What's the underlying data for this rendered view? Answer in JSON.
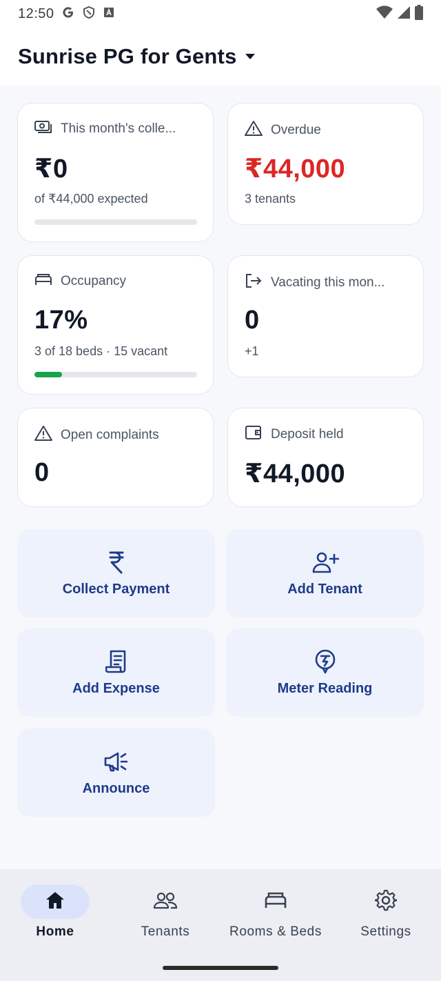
{
  "status_bar": {
    "time": "12:50",
    "left_icons": [
      "google-icon",
      "shield-icon",
      "font-icon"
    ],
    "right_icons": [
      "wifi-icon",
      "signal-icon",
      "battery-icon"
    ]
  },
  "header": {
    "title": "Sunrise PG for Gents"
  },
  "stats": {
    "collection": {
      "label": "This month's colle...",
      "value": "₹0",
      "sub": "of ₹44,000 expected",
      "progress": 0
    },
    "overdue": {
      "label": "Overdue",
      "value": "₹44,000",
      "sub": "3 tenants",
      "value_color": "#dc2626"
    },
    "occupancy": {
      "label": "Occupancy",
      "value": "17%",
      "sub": "3 of 18 beds · 15 vacant",
      "progress": 0.17
    },
    "vacating": {
      "label": "Vacating this mon...",
      "value": "0",
      "sub": "+1"
    },
    "complaints": {
      "label": "Open complaints",
      "value": "0"
    },
    "deposit": {
      "label": "Deposit held",
      "value": "₹44,000"
    }
  },
  "actions": {
    "collect_payment": "Collect Payment",
    "add_tenant": "Add Tenant",
    "add_expense": "Add Expense",
    "meter_reading": "Meter Reading",
    "announce": "Announce"
  },
  "nav": {
    "home": "Home",
    "tenants": "Tenants",
    "rooms": "Rooms & Beds",
    "settings": "Settings",
    "active": "home"
  },
  "colors": {
    "accent": "#1e3a8a",
    "action_bg": "#eef2fc",
    "progress_green": "#16a34a",
    "overdue_red": "#dc2626"
  }
}
